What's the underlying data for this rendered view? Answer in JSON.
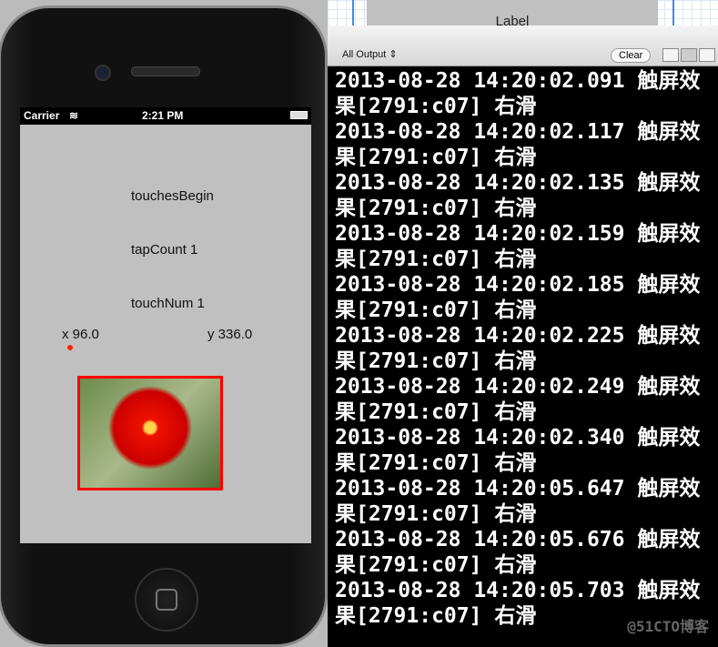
{
  "ib": {
    "label": "Label"
  },
  "console_header": {
    "filter": "All Output ⇕",
    "clear": "Clear"
  },
  "logs": [
    "2013-08-28 14:20:02.091 触屏效果[2791:c07] 右滑",
    "2013-08-28 14:20:02.117 触屏效果[2791:c07] 右滑",
    "2013-08-28 14:20:02.135 触屏效果[2791:c07] 右滑",
    "2013-08-28 14:20:02.159 触屏效果[2791:c07] 右滑",
    "2013-08-28 14:20:02.185 触屏效果[2791:c07] 右滑",
    "2013-08-28 14:20:02.225 触屏效果[2791:c07] 右滑",
    "2013-08-28 14:20:02.249 触屏效果[2791:c07] 右滑",
    "2013-08-28 14:20:02.340 触屏效果[2791:c07] 右滑",
    "2013-08-28 14:20:05.647 触屏效果[2791:c07] 右滑",
    "2013-08-28 14:20:05.676 触屏效果[2791:c07] 右滑",
    "2013-08-28 14:20:05.703 触屏效果[2791:c07] 右滑"
  ],
  "watermark": "@51CTO博客",
  "phone": {
    "carrier": "Carrier",
    "time": "2:21 PM",
    "touch_state": "touchesBegin",
    "tap_count": "tapCount 1",
    "touch_num": "touchNum 1",
    "x": "x 96.0",
    "y": "y 336.0",
    "accent": "#ff0000"
  }
}
